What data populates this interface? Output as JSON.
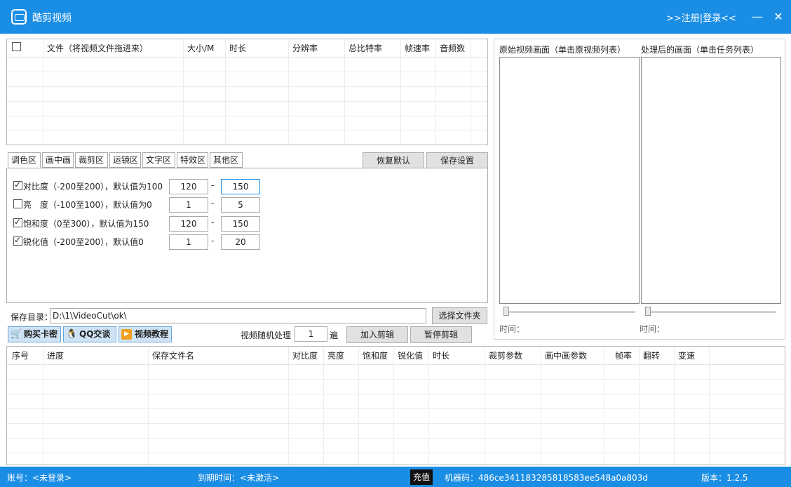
{
  "app": {
    "title": "酷剪视频",
    "login_text": ">>注册|登录<<",
    "min_label": "—",
    "close_label": "✕"
  },
  "file_table": {
    "headers": [
      "文件（将视频文件拖进来）",
      "大小/M",
      "时长",
      "分辨率",
      "总比特率",
      "帧速率",
      "音频数"
    ]
  },
  "tabs": [
    "调色区",
    "画中画",
    "裁剪区",
    "运镜区",
    "文字区",
    "特效区",
    "其他区"
  ],
  "buttons": {
    "restore_default": "恢复默认",
    "save_settings": "保存设置",
    "choose_folder": "选择文件夹",
    "add_edit": "加入剪辑",
    "pause_edit": "暂停剪辑"
  },
  "params": [
    {
      "label": "对比度（-200至200），默认值为100",
      "checked": true,
      "min": "120",
      "max": "150"
    },
    {
      "label": "亮　度（-100至100），默认值为0",
      "checked": false,
      "min": "1",
      "max": "5"
    },
    {
      "label": "饱和度（0至300），默认值为150",
      "checked": true,
      "min": "120",
      "max": "150"
    },
    {
      "label": "锐化值（-200至200），默认值0",
      "checked": true,
      "min": "1",
      "max": "20"
    }
  ],
  "range_sep": "-",
  "preview": {
    "original_label": "原始视频画面（单击原视频列表）",
    "processed_label": "处理后的画面（单击任务列表）",
    "time_label_1": "时间：",
    "time_label_2": "时间："
  },
  "save_dir": {
    "label": "保存目录：",
    "value": "D:\\1\\VideoCut\\ok\\"
  },
  "promo": {
    "buy_card": "购买卡密",
    "qq_chat": "QQ交谈",
    "video_tutorial": "视频教程"
  },
  "random": {
    "label": "视频随机处理",
    "value": "1",
    "unit": "遍"
  },
  "task_table": {
    "headers": [
      "序号",
      "进度",
      "保存文件名",
      "对比度",
      "亮度",
      "饱和度",
      "锐化值",
      "时长",
      "裁剪参数",
      "画中画参数",
      "帧率",
      "翻转",
      "变速"
    ]
  },
  "status": {
    "account": "账号：<未登录>",
    "expire": "到期时间：<未激活>",
    "recharge": "充值",
    "machine_code": "机器码：486ce341183285818583ee548a0a803d",
    "version": "版本：1.2.5"
  },
  "colors": {
    "accent": "#1a8de4"
  }
}
